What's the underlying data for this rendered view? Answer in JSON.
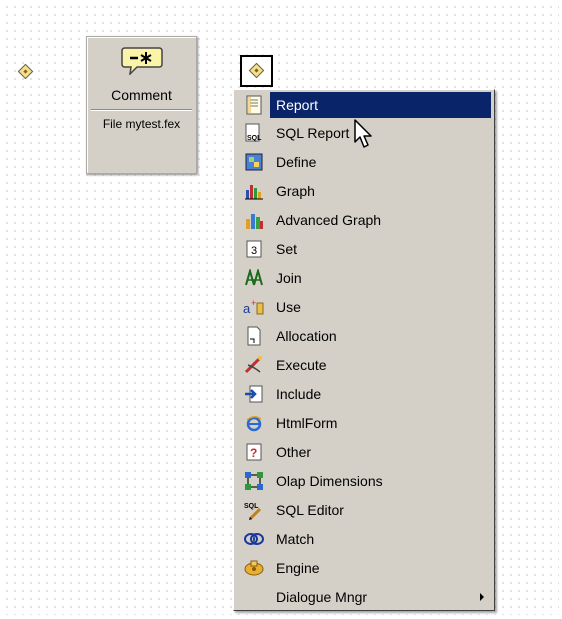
{
  "comment_node": {
    "label": "Comment",
    "file": "File mytest.fex"
  },
  "context_menu": {
    "items": [
      {
        "label": "Report",
        "icon": "report-icon",
        "selected": true
      },
      {
        "label": "SQL Report",
        "icon": "sql-report-icon"
      },
      {
        "label": "Define",
        "icon": "define-icon"
      },
      {
        "label": "Graph",
        "icon": "graph-icon"
      },
      {
        "label": "Advanced Graph",
        "icon": "advanced-graph-icon"
      },
      {
        "label": "Set",
        "icon": "set-icon"
      },
      {
        "label": "Join",
        "icon": "join-icon"
      },
      {
        "label": "Use",
        "icon": "use-icon"
      },
      {
        "label": "Allocation",
        "icon": "allocation-icon"
      },
      {
        "label": "Execute",
        "icon": "execute-icon"
      },
      {
        "label": "Include",
        "icon": "include-icon"
      },
      {
        "label": "HtmlForm",
        "icon": "htmlform-icon"
      },
      {
        "label": "Other",
        "icon": "other-icon"
      },
      {
        "label": "Olap Dimensions",
        "icon": "olap-dimensions-icon"
      },
      {
        "label": "SQL Editor",
        "icon": "sql-editor-icon"
      },
      {
        "label": "Match",
        "icon": "match-icon"
      },
      {
        "label": "Engine",
        "icon": "engine-icon"
      },
      {
        "label": "Dialogue Mngr",
        "icon": "",
        "submenu": true
      }
    ]
  },
  "colors": {
    "menu_background": "#d4d0c8",
    "selection": "#0a246a",
    "diamond_fill": "#f6df8a"
  }
}
